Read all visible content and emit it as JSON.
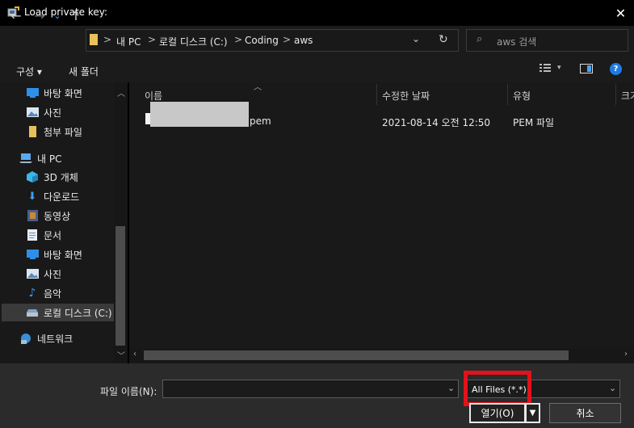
{
  "window": {
    "title": "Load private key:"
  },
  "address": {
    "crumbs": [
      "내 PC",
      "로컬 디스크 (C:)",
      "Coding",
      "aws"
    ],
    "separator": ">",
    "search_placeholder": "aws 검색"
  },
  "toolbar": {
    "organize": "구성 ▾",
    "new_folder": "새 폴더"
  },
  "nav": {
    "items": [
      {
        "label": "바탕 화면",
        "icon": "desktop-icon"
      },
      {
        "label": "사진",
        "icon": "pictures-icon"
      },
      {
        "label": "첨부 파일",
        "icon": "folder-icon"
      },
      {
        "label": "내 PC",
        "icon": "pc-icon"
      },
      {
        "label": "3D 개체",
        "icon": "3d-objects-icon"
      },
      {
        "label": "다운로드",
        "icon": "download-icon"
      },
      {
        "label": "동영상",
        "icon": "videos-icon"
      },
      {
        "label": "문서",
        "icon": "documents-icon"
      },
      {
        "label": "바탕 화면",
        "icon": "desktop-icon"
      },
      {
        "label": "사진",
        "icon": "pictures-icon"
      },
      {
        "label": "음악",
        "icon": "music-icon"
      },
      {
        "label": "로컬 디스크 (C:)",
        "icon": "drive-icon"
      },
      {
        "label": "네트워크",
        "icon": "network-icon"
      }
    ]
  },
  "columns": {
    "name": "이름",
    "date": "수정한 날짜",
    "type": "유형",
    "size": "크기"
  },
  "files": [
    {
      "name_suffix": "pem",
      "date": "2021-08-14 오전 12:50",
      "type": "PEM 파일"
    }
  ],
  "bottom": {
    "filename_label": "파일 이름(N):",
    "filename_value": "",
    "filter": "All Files (*.*)",
    "open": "열기(O)",
    "cancel": "취소"
  },
  "colors": {
    "highlight": "#e3121a",
    "accent": "#0078d4"
  }
}
